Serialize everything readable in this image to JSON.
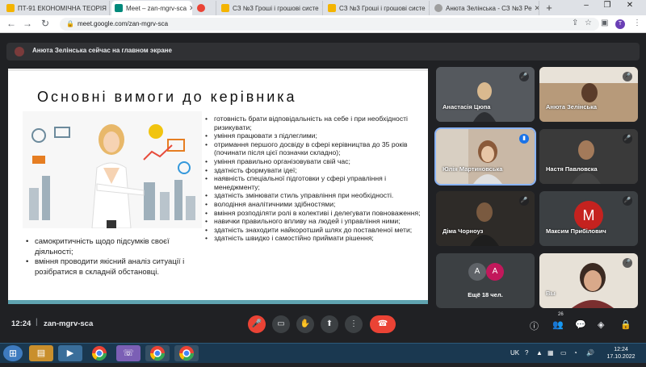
{
  "browser": {
    "tabs": [
      {
        "title": "ПТ-91 ЕКОНОМІЧНА ТЕОРІЯ",
        "color": "#f4b400"
      },
      {
        "title": "Meet – zan-mgrv-sca",
        "color": "#00897b"
      },
      {
        "title": "",
        "color": "#ea4335"
      },
      {
        "title": "СЗ №3 Гроші і грошові систе",
        "color": "#f4b400"
      },
      {
        "title": "СЗ №3 Гроші і грошові систе",
        "color": "#f4b400"
      },
      {
        "title": "Анюта Зелінська - СЗ №3 Ре",
        "color": "#9e9e9e"
      }
    ],
    "new_tab": "+",
    "minimize": "–",
    "maximize": "❐",
    "close": "✕",
    "url": "meet.google.com/zan-mgrv-sca",
    "profile_initial": "T"
  },
  "meet": {
    "presenter_text": "Анюта Зелінська сейчас на главном экране",
    "slide": {
      "title": "Основні вимоги до керівника",
      "left_bullets": [
        "самокритичність щодо підсумків своєї діяльності;",
        "вміння проводити якісний аналіз ситуації і розібратися в складній обстановці."
      ],
      "right_bullets": [
        "готовність брати відповідальність на себе і при необхідності ризикувати;",
        "уміння працювати з підлеглими;",
        "отримання першого досвіду в сфері керівництва до 35 років (починати після цієї позначки складно);",
        "уміння правильно організовувати свій час;",
        "здатність формувати ідеї;",
        "наявність спеціальної підготовки у сфері управління і менеджменту;",
        "здатність змінювати стиль управління при необхідності.",
        "володіння аналітичними здібностями;",
        "вміння розподіляти ролі в колективі і делегувати повноваження;",
        "навички правильного впливу на людей і управління ними;",
        "здатність знаходити найкоротший шлях до поставленої мети;",
        "здатність швидко і самостійно приймати рішення;"
      ]
    },
    "participants": [
      {
        "name": "Анастасія Цюпа"
      },
      {
        "name": "Анюта Зелінська"
      },
      {
        "name": "Юлія Мартиновська"
      },
      {
        "name": "Настя Павловска"
      },
      {
        "name": "Діма Чорноуз"
      },
      {
        "name": "Максим Прибілович",
        "initial": "M"
      },
      {
        "name": "Ещё 18 чел.",
        "initials": [
          "A",
          "A"
        ]
      },
      {
        "name": "Вы"
      }
    ],
    "bottom": {
      "time": "12:24",
      "separator": "|",
      "code": "zan-mgrv-sca",
      "people_count": "26"
    }
  },
  "taskbar": {
    "lang": "UK",
    "time": "12:24",
    "date": "17.10.2022"
  }
}
